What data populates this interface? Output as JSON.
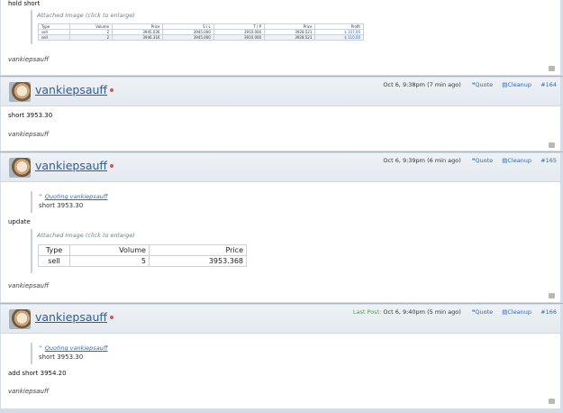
{
  "posts": [
    {
      "id": "post-top",
      "text": "hold short",
      "attachment_label": "Attached Image (click to enlarge)",
      "table": {
        "headers": [
          "Type",
          "Volume",
          "Price",
          "S / L",
          "T / P",
          "Price",
          "Profit"
        ],
        "rows": [
          [
            "sell",
            "2",
            "3945.036",
            "3945.000",
            "3910.000",
            "3928.521",
            "$ 107.00"
          ],
          [
            "sell",
            "2",
            "3946.316",
            "3945.000",
            "3910.000",
            "3928.521",
            "$ 110.00"
          ]
        ]
      },
      "signature": "vankiepsauff"
    },
    {
      "id": "post-164",
      "username": "vankiepsauff",
      "timestamp": "Oct 6, 9:38pm (7 min ago)",
      "quote_label": "Quote",
      "cleanup_label": "Cleanup",
      "post_number": "#164",
      "text": "short 3953.30",
      "signature": "vankiepsauff"
    },
    {
      "id": "post-165",
      "username": "vankiepsauff",
      "timestamp": "Oct 6, 9:39pm (6 min ago)",
      "quote_label": "Quote",
      "cleanup_label": "Cleanup",
      "post_number": "#165",
      "quoting_label": "Quoting vankiepsauff",
      "quoted_text": "short 3953.30",
      "text": "update",
      "attachment_label": "Attached Image (click to enlarge)",
      "table": {
        "headers": [
          "Type",
          "Volume",
          "Price"
        ],
        "rows": [
          [
            "sell",
            "5",
            "3953.368"
          ]
        ]
      },
      "signature": "vankiepsauff"
    },
    {
      "id": "post-166",
      "username": "vankiepsauff",
      "last_post_label": "Last Post:",
      "timestamp": "Oct 6, 9:40pm (5 min ago)",
      "quote_label": "Quote",
      "cleanup_label": "Cleanup",
      "post_number": "#166",
      "quoting_label": "Quoting vankiepsauff",
      "quoted_text": "short 3953.30",
      "text": "add short 3954.20",
      "signature": "vankiepsauff"
    }
  ],
  "icons": {
    "quote": "quote-icon",
    "cleanup": "cleanup-icon",
    "like": "thumbs-up-icon",
    "status": "online-dot-icon"
  },
  "colors": {
    "link": "#2f6bb0",
    "username": "#2f5f96",
    "last_post": "#4aa84a",
    "status_dot": "#e05252"
  }
}
